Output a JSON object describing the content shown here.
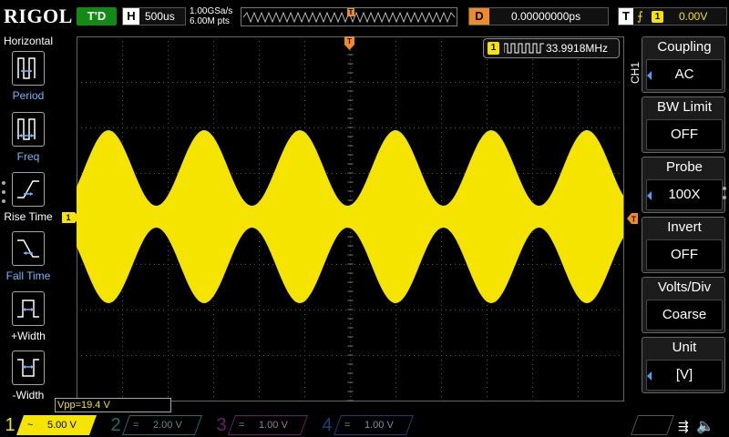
{
  "brand": {
    "logo": "RIGOL"
  },
  "topbar": {
    "run_state": "T'D",
    "horizontal_key": "H",
    "timebase": "500us",
    "sample_rate": "1.00GSa/s",
    "mem_depth": "6.00M pts",
    "trigger_marker": "T",
    "delay_key": "D",
    "delay_value": "0.00000000ps",
    "trigger_key": "T",
    "trigger_edge": "⨍",
    "trigger_source": "1",
    "trigger_level": "0.00V"
  },
  "left_menu": {
    "title": "Horizontal",
    "items": [
      {
        "label": "Period",
        "icon": "period-icon"
      },
      {
        "label": "Freq",
        "icon": "freq-icon"
      },
      {
        "label": "Rise Time",
        "icon": "rise-time-icon"
      },
      {
        "label": "Fall Time",
        "icon": "fall-time-icon"
      },
      {
        "label": "+Width",
        "icon": "plus-width-icon"
      },
      {
        "label": "-Width",
        "icon": "minus-width-icon"
      }
    ]
  },
  "screen": {
    "frequency_channel": "1",
    "frequency_value": "33.9918MHz",
    "channel_marker": "1",
    "trace_color": "#f5e400"
  },
  "side_label": "CH1",
  "right_menu": [
    {
      "title": "Coupling",
      "value": "AC",
      "has_arrow": true
    },
    {
      "title": "BW Limit",
      "value": "OFF",
      "has_arrow": false
    },
    {
      "title": "Probe",
      "value": "100X",
      "has_arrow": true
    },
    {
      "title": "Invert",
      "value": "OFF",
      "has_arrow": false
    },
    {
      "title": "Volts/Div",
      "value": "Coarse",
      "has_arrow": false
    },
    {
      "title": "Unit",
      "value": "[V]",
      "has_arrow": true
    }
  ],
  "measurement": "Vpp=19.4 V",
  "channels": [
    {
      "num": "1",
      "coupling": "~",
      "scale": "5.00 V",
      "color": "#f5e400"
    },
    {
      "num": "2",
      "coupling": "=",
      "scale": "2.00 V",
      "color": "#1b6e6e"
    },
    {
      "num": "3",
      "coupling": "=",
      "scale": "1.00 V",
      "color": "#6d1a6d"
    },
    {
      "num": "4",
      "coupling": "=",
      "scale": "1.00 V",
      "color": "#1d3f7a"
    }
  ],
  "status_icons": {
    "usb": "usb-icon",
    "speaker": "speaker-icon"
  }
}
